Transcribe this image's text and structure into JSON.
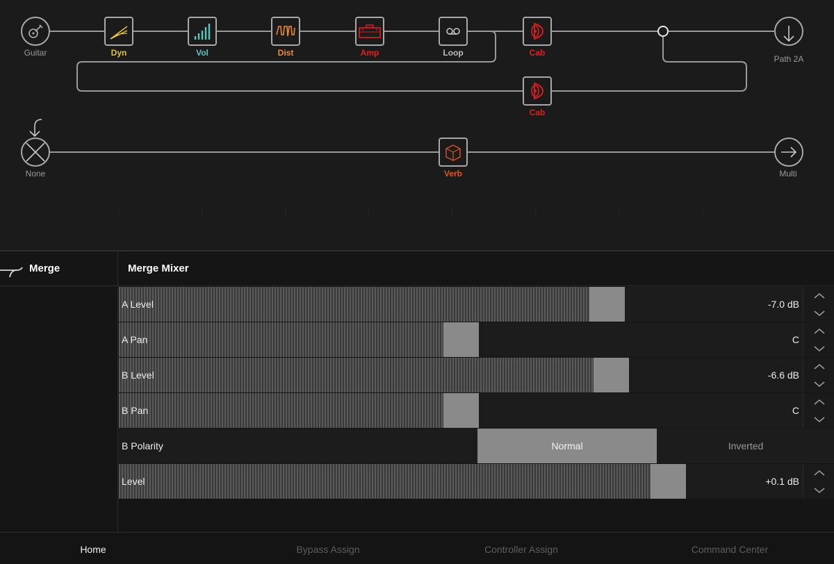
{
  "colors": {
    "dyn": "#e6c23a",
    "vol": "#5cc6c0",
    "dist": "#f08a2c",
    "amp": "#e0201e",
    "cab": "#e0201e",
    "verb": "#e0541e",
    "neutral": "#a9a9a9"
  },
  "chain": {
    "path1": {
      "input_label": "Guitar",
      "blocks": [
        {
          "label": "Dyn",
          "icon": "dynamics-icon"
        },
        {
          "label": "Vol",
          "icon": "volume-bars-icon"
        },
        {
          "label": "Dist",
          "icon": "distortion-wave-icon"
        },
        {
          "label": "Amp",
          "icon": "amp-head-icon"
        },
        {
          "label": "Loop",
          "icon": "tape-loop-icon"
        },
        {
          "label": "Cab",
          "icon": "speaker-icon"
        }
      ],
      "lower_block": {
        "label": "Cab",
        "icon": "speaker-icon"
      },
      "output_label": "Path 2A"
    },
    "path2": {
      "input_label": "None",
      "block": {
        "label": "Verb",
        "icon": "reverb-cube-icon"
      },
      "output_label": "Multi"
    }
  },
  "sidebar": {
    "title": "Merge"
  },
  "panel": {
    "title": "Merge Mixer",
    "params": [
      {
        "label": "A Level",
        "value": "-7.0 dB",
        "level": 0.726
      },
      {
        "label": "A Pan",
        "value": "C",
        "level": 0.5
      },
      {
        "label": "B Level",
        "value": "-6.6 dB",
        "level": 0.732
      },
      {
        "label": "B Pan",
        "value": "C",
        "level": 0.5
      }
    ],
    "polarity": {
      "label": "B Polarity",
      "options": [
        "Normal",
        "Inverted"
      ],
      "selected": "Normal"
    },
    "level": {
      "label": "Level",
      "value": "+0.1 dB",
      "level": 0.82
    }
  },
  "tabs": [
    {
      "label": "Home",
      "active": true
    },
    {
      "label": "Bypass Assign",
      "active": false
    },
    {
      "label": "Controller Assign",
      "active": false
    },
    {
      "label": "Command Center",
      "active": false
    }
  ]
}
